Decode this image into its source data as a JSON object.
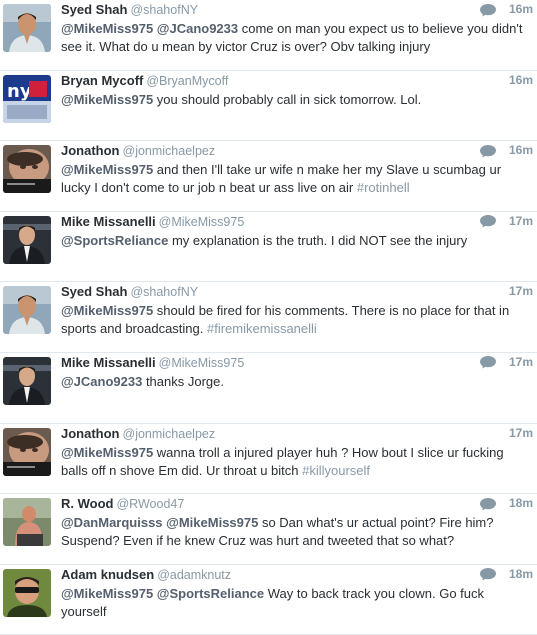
{
  "tweets": [
    {
      "name": "Syed Shah",
      "handle": "@shahofNY",
      "time": "16m",
      "show_reply": true,
      "avatar": "avatar-syed",
      "segments": [
        {
          "t": "mention",
          "v": "@MikeMiss975"
        },
        {
          "t": "text",
          "v": " "
        },
        {
          "t": "mention",
          "v": "@JCano9233"
        },
        {
          "t": "text",
          "v": " come on man you expect us to believe you didn't see it. What do u mean by victor Cruz is over? Obv  talking injury"
        }
      ]
    },
    {
      "name": "Bryan Mycoff",
      "handle": "@BryanMycoff",
      "time": "16m",
      "show_reply": false,
      "avatar": "avatar-bryan",
      "segments": [
        {
          "t": "mention",
          "v": "@MikeMiss975"
        },
        {
          "t": "text",
          "v": " you should probably call in sick tomorrow. Lol."
        }
      ]
    },
    {
      "name": "Jonathon",
      "handle": "@jonmichaelpez",
      "time": "16m",
      "show_reply": true,
      "avatar": "avatar-jonathon",
      "segments": [
        {
          "t": "mention",
          "v": "@MikeMiss975"
        },
        {
          "t": "text",
          "v": " and then I'll take ur wife n make her my Slave u scumbag ur lucky I don't come to ur job n beat ur ass live on air "
        },
        {
          "t": "hashtag",
          "v": "#rotinhell"
        }
      ]
    },
    {
      "name": "Mike Missanelli",
      "handle": "@MikeMiss975",
      "time": "17m",
      "show_reply": true,
      "avatar": "avatar-mike",
      "segments": [
        {
          "t": "mention",
          "v": "@SportsReliance"
        },
        {
          "t": "text",
          "v": " my explanation is the truth. I did NOT see the injury"
        }
      ]
    },
    {
      "name": "Syed Shah",
      "handle": "@shahofNY",
      "time": "17m",
      "show_reply": false,
      "avatar": "avatar-syed",
      "segments": [
        {
          "t": "mention",
          "v": "@MikeMiss975"
        },
        {
          "t": "text",
          "v": " should be fired for his comments. There is no place for that in sports and broadcasting. "
        },
        {
          "t": "hashtag",
          "v": "#firemikemissanelli"
        }
      ]
    },
    {
      "name": "Mike Missanelli",
      "handle": "@MikeMiss975",
      "time": "17m",
      "show_reply": true,
      "avatar": "avatar-mike",
      "segments": [
        {
          "t": "mention",
          "v": "@JCano9233"
        },
        {
          "t": "text",
          "v": " thanks Jorge."
        }
      ]
    },
    {
      "name": "Jonathon",
      "handle": "@jonmichaelpez",
      "time": "17m",
      "show_reply": false,
      "avatar": "avatar-jonathon",
      "segments": [
        {
          "t": "mention",
          "v": "@MikeMiss975"
        },
        {
          "t": "text",
          "v": " wanna troll a injured player huh ? How bout I slice ur fucking balls off n shove Em did. Ur throat u bitch  "
        },
        {
          "t": "hashtag",
          "v": "#killyourself"
        }
      ]
    },
    {
      "name": "R. Wood",
      "handle": "@RWood47",
      "time": "18m",
      "show_reply": true,
      "avatar": "avatar-rwood",
      "segments": [
        {
          "t": "mention",
          "v": "@DanMarquisss"
        },
        {
          "t": "text",
          "v": " "
        },
        {
          "t": "mention",
          "v": "@MikeMiss975"
        },
        {
          "t": "text",
          "v": " so Dan what's ur actual point? Fire him? Suspend? Even if he knew Cruz was hurt and tweeted that so what?"
        }
      ]
    },
    {
      "name": "Adam knudsen",
      "handle": "@adamknutz",
      "time": "18m",
      "show_reply": true,
      "avatar": "avatar-adam",
      "segments": [
        {
          "t": "mention",
          "v": "@MikeMiss975"
        },
        {
          "t": "text",
          "v": " "
        },
        {
          "t": "mention",
          "v": "@SportsReliance"
        },
        {
          "t": "text",
          "v": " Way to back track you clown. Go fuck yourself"
        }
      ]
    }
  ]
}
